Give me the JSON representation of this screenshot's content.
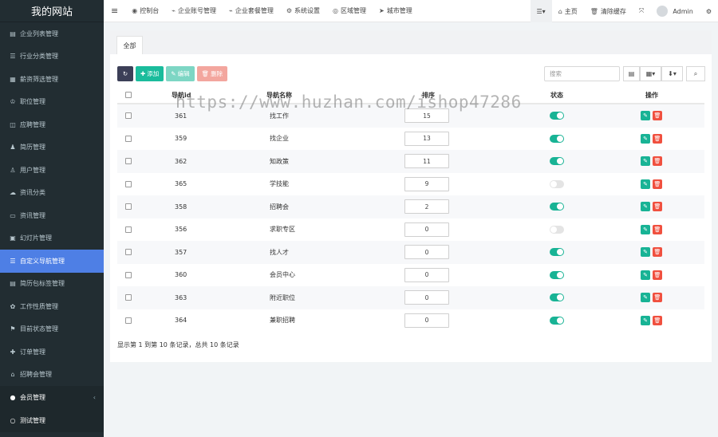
{
  "sidebar": {
    "logo": "我的网站",
    "items": [
      {
        "label": "企业列表管理",
        "icon": "▤",
        "icon_name": "list-icon"
      },
      {
        "label": "行业分类管理",
        "icon": "☰",
        "icon_name": "bars-icon"
      },
      {
        "label": "薪资筛选管理",
        "icon": "▦",
        "icon_name": "grid-icon"
      },
      {
        "label": "职位管理",
        "icon": "♔",
        "icon_name": "org-icon"
      },
      {
        "label": "应聘管理",
        "icon": "◫",
        "icon_name": "book-icon"
      },
      {
        "label": "简历管理",
        "icon": "♟",
        "icon_name": "users-icon"
      },
      {
        "label": "用户管理",
        "icon": "♙",
        "icon_name": "user-icon"
      },
      {
        "label": "资讯分类",
        "icon": "☁",
        "icon_name": "cloud-icon"
      },
      {
        "label": "资讯管理",
        "icon": "▭",
        "icon_name": "news-icon"
      },
      {
        "label": "幻灯片管理",
        "icon": "▣",
        "icon_name": "image-icon"
      },
      {
        "label": "自定义导航管理",
        "icon": "☰",
        "icon_name": "nav-icon",
        "active": true
      },
      {
        "label": "简历包标签管理",
        "icon": "▤",
        "icon_name": "tag-icon"
      },
      {
        "label": "工作性质管理",
        "icon": "✿",
        "icon_name": "gear-icon"
      },
      {
        "label": "目前状态管理",
        "icon": "⚑",
        "icon_name": "flag-icon"
      },
      {
        "label": "订单管理",
        "icon": "✚",
        "icon_name": "plus-icon"
      },
      {
        "label": "招聘会管理",
        "icon": "⌂",
        "icon_name": "bank-icon"
      }
    ],
    "groups": [
      {
        "label": "会员管理",
        "icon": "●",
        "icon_name": "member-icon",
        "arrow": "‹"
      },
      {
        "label": "测试管理",
        "icon": "○",
        "icon_name": "circle-icon"
      }
    ]
  },
  "topbar": {
    "menu_icon": "≡",
    "items": [
      {
        "label": "控制台",
        "icon": "◉",
        "icon_name": "dashboard-icon"
      },
      {
        "label": "企业账号管理",
        "icon": "⌁",
        "icon_name": "rss-icon"
      },
      {
        "label": "企业套餐管理",
        "icon": "⌁",
        "icon_name": "rss-icon-2"
      },
      {
        "label": "系统设置",
        "icon": "⚙",
        "icon_name": "cogs-icon"
      },
      {
        "label": "区域管理",
        "icon": "◎",
        "icon_name": "target-icon"
      },
      {
        "label": "城市管理",
        "icon": "➤",
        "icon_name": "location-icon"
      }
    ],
    "right": {
      "list_icon": "☰▾",
      "home_label": "主页",
      "home_icon": "⌂",
      "clear_label": "清除缓存",
      "clear_icon": "🗑",
      "fullscreen_icon": "⤧",
      "user_label": "Admin",
      "settings_icon": "⚙"
    }
  },
  "panel": {
    "tab_label": "全部",
    "buttons": {
      "refresh_icon": "↻",
      "add_label": "添加",
      "add_icon": "✚",
      "edit_label": "编辑",
      "edit_icon": "✎",
      "delete_label": "删除",
      "delete_icon": "🗑"
    },
    "search_placeholder": "搜索",
    "tool_icons": {
      "columns": "▤",
      "grid": "▦▾",
      "export": "⬇▾",
      "search": "⌕"
    },
    "table": {
      "headers": {
        "id": "导航id",
        "name": "导航名称",
        "sort": "排序",
        "status": "状态",
        "ops": "操作"
      },
      "rows": [
        {
          "id": "361",
          "name": "找工作",
          "sort": "15",
          "on": true
        },
        {
          "id": "359",
          "name": "找企业",
          "sort": "13",
          "on": true
        },
        {
          "id": "362",
          "name": "知政策",
          "sort": "11",
          "on": true
        },
        {
          "id": "365",
          "name": "学技能",
          "sort": "9",
          "on": false
        },
        {
          "id": "358",
          "name": "招聘会",
          "sort": "2",
          "on": true
        },
        {
          "id": "356",
          "name": "求职专区",
          "sort": "0",
          "on": false
        },
        {
          "id": "357",
          "name": "找人才",
          "sort": "0",
          "on": true
        },
        {
          "id": "360",
          "name": "会员中心",
          "sort": "0",
          "on": true
        },
        {
          "id": "363",
          "name": "附近职位",
          "sort": "0",
          "on": true
        },
        {
          "id": "364",
          "name": "兼职招聘",
          "sort": "0",
          "on": true
        }
      ]
    },
    "footer": "显示第 1 到第 10 条记录，总共 10 条记录"
  },
  "watermark": "https://www.huzhan.com/ishop47286",
  "colors": {
    "sidebar": "#222d32",
    "active": "#4e7fe5",
    "accent": "#18b395",
    "danger": "#f0503f"
  }
}
